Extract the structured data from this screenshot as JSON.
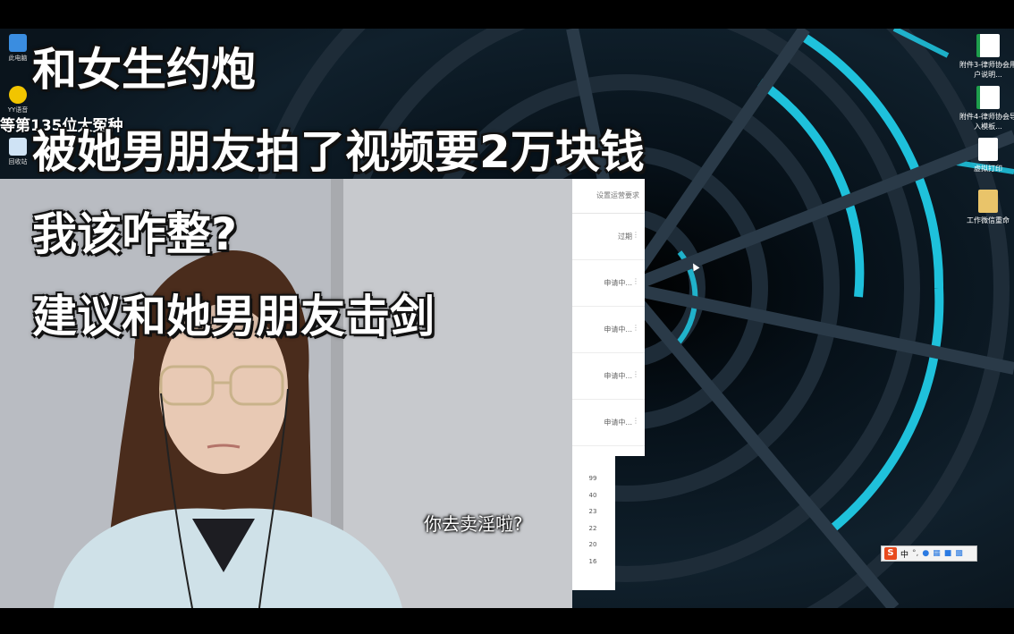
{
  "captions": {
    "line1": "和女生约炮",
    "line2": "被她男朋友拍了视频要2万块钱",
    "line3": "我该咋整?",
    "line4": "建议和她男朋友击剑"
  },
  "subtitle": "你去卖淫啦?",
  "overlay_banner": "等第135位大冤种",
  "desktop_icons_left": [
    {
      "label": "此电脑",
      "icon": "computer-icon"
    },
    {
      "label": "YY语音",
      "icon": "yy-icon"
    },
    {
      "label": "回收站",
      "icon": "recycle-bin-icon"
    }
  ],
  "desktop_icons_right": [
    {
      "label": "附件3-律师协会用户说明...",
      "icon": "spreadsheet-file-icon"
    },
    {
      "label": "附件4-律师协会导入模板...",
      "icon": "spreadsheet-file-icon"
    },
    {
      "label": "虚拟打印",
      "icon": "document-file-icon"
    },
    {
      "label": "工作微信重命",
      "icon": "folder-zip-icon"
    }
  ],
  "panel": {
    "header": "设置运营要求",
    "rows": [
      {
        "status": "过期"
      },
      {
        "status": "申请中..."
      },
      {
        "status": "申请中..."
      },
      {
        "status": "申请中..."
      },
      {
        "status": "申请中..."
      }
    ],
    "numbers": [
      "99",
      "40",
      "23",
      "22",
      "20",
      "16"
    ]
  },
  "taskbar": {
    "ime_logo": "S",
    "ime_lang": "中",
    "tray_icons": [
      "punctuation-icon",
      "microphone-icon",
      "keyboard-icon",
      "skin-icon",
      "settings-grid-icon"
    ]
  },
  "colors": {
    "tunnel_cyan": "#21d4f0",
    "tunnel_dark": "#0b1a24",
    "caption_text": "#ffffff"
  }
}
